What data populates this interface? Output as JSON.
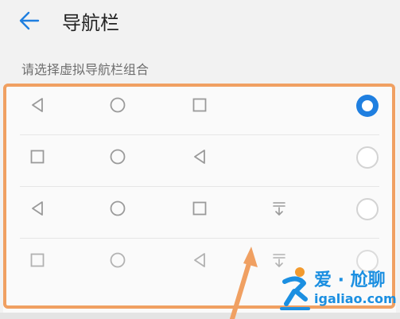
{
  "header": {
    "title": "导航栏",
    "back_icon": "arrow-left-icon"
  },
  "section_label": "请选择虚拟导航栏组合",
  "options": [
    {
      "keys": [
        "back-triangle-icon",
        "home-circle-icon",
        "recents-square-icon"
      ],
      "selected": true
    },
    {
      "keys": [
        "recents-square-icon",
        "home-circle-icon",
        "back-triangle-icon"
      ],
      "selected": false
    },
    {
      "keys": [
        "back-triangle-icon",
        "home-circle-icon",
        "recents-square-icon",
        "notification-pulldown-icon"
      ],
      "selected": false
    },
    {
      "keys": [
        "recents-square-icon",
        "home-circle-icon",
        "back-triangle-icon",
        "notification-pulldown-icon"
      ],
      "selected": false
    }
  ],
  "colors": {
    "accent": "#1f7fe0",
    "annotation": "#f0a062",
    "icon": "#9a9a9a"
  },
  "watermark": {
    "text": "爱 · 尬聊",
    "url": "igaliao.com"
  }
}
